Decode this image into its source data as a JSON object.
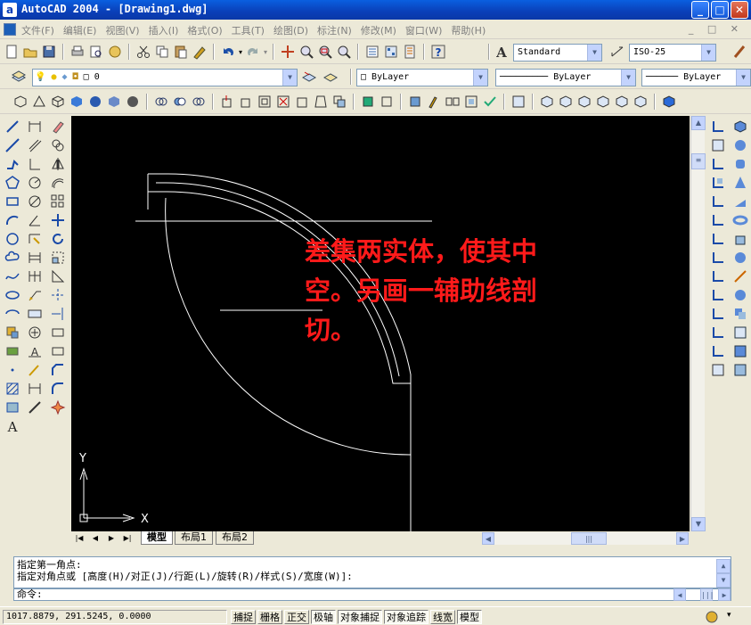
{
  "window": {
    "title": "AutoCAD 2004 - [Drawing1.dwg]",
    "app_icon": "a"
  },
  "menu": {
    "items": [
      "文件(F)",
      "编辑(E)",
      "视图(V)",
      "插入(I)",
      "格式(O)",
      "工具(T)",
      "绘图(D)",
      "标注(N)",
      "修改(M)",
      "窗口(W)",
      "帮助(H)"
    ]
  },
  "toolbar": {
    "text_style": "Standard",
    "dim_style": "ISO-25",
    "layer": "0",
    "color": "ByLayer",
    "linetype": "ByLayer",
    "lineweight": "ByLayer"
  },
  "canvas": {
    "annotation": "差集两实体，使其中空。另画一辅助线剖切。",
    "axis_x": "X",
    "axis_y": "Y",
    "background": "#000000",
    "line_color": "#ffffff",
    "annotation_color": "#ff1a1a"
  },
  "tabs": {
    "model": "模型",
    "layout1": "布局1",
    "layout2": "布局2"
  },
  "command": {
    "line1": "指定第一角点:",
    "line2": "指定对角点或 [高度(H)/对正(J)/行距(L)/旋转(R)/样式(S)/宽度(W)]:",
    "prompt": "命令:"
  },
  "status": {
    "coords": "1017.8879, 291.5245, 0.0000",
    "buttons": [
      "捕捉",
      "栅格",
      "正交",
      "极轴",
      "对象捕捉",
      "对象追踪",
      "线宽",
      "模型"
    ]
  }
}
